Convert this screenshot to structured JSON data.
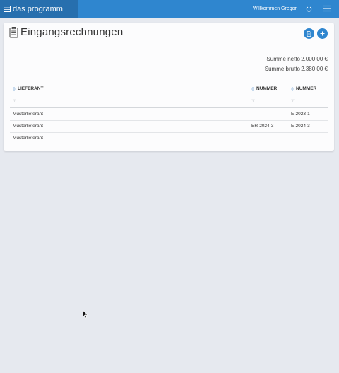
{
  "topbar": {
    "brand_label": "das programm",
    "welcome_text": "Willkommen Gregor"
  },
  "page": {
    "title": "Eingangsrechnungen"
  },
  "summary": {
    "net_label": "Summe netto",
    "net_value": "2.000,00 €",
    "gross_label": "Summe brutto",
    "gross_value": "2.380,00 €"
  },
  "table": {
    "columns": [
      "LIEFERANT",
      "NUMMER",
      "NUMMER"
    ],
    "rows": [
      [
        "Musterlieferant",
        "",
        "E-2023-1"
      ],
      [
        "Musterlieferant",
        "ER-2024-3",
        "E-2024-3"
      ],
      [
        "Musterlieferant",
        "",
        ""
      ]
    ]
  },
  "colors": {
    "primary": "#2f86cf",
    "primary_dark": "#276fae",
    "background": "#e6e9ef"
  }
}
